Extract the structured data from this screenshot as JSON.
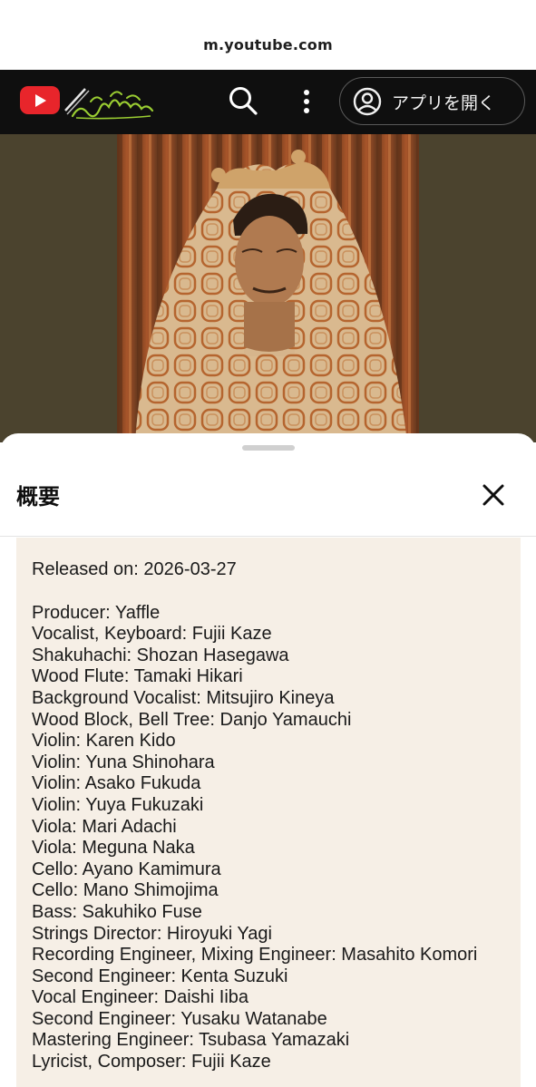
{
  "browser": {
    "url": "m.youtube.com"
  },
  "header": {
    "logo_icon": "youtube-logo-icon",
    "doodle_icon": "youtube-doodle-icon",
    "search_icon": "search-icon",
    "more_icon": "more-vert-icon",
    "open_app_label": "アプリを開く",
    "open_app_icon": "account-circle-icon"
  },
  "sheet": {
    "title": "概要",
    "close_icon": "close-icon",
    "released": "Released on: 2026-03-27",
    "credits": [
      "Producer: Yaffle",
      "Vocalist, Keyboard: Fujii Kaze",
      "Shakuhachi: Shozan Hasegawa",
      "Wood Flute: Tamaki Hikari",
      "Background Vocalist: Mitsujiro Kineya",
      "Wood Block, Bell Tree: Danjo Yamauchi",
      "Violin: Karen Kido",
      "Violin: Yuna Shinohara",
      "Violin: Asako Fukuda",
      "Violin: Yuya Fukuzaki",
      "Viola: Mari Adachi",
      "Viola: Meguna Naka",
      "Cello: Ayano Kamimura",
      "Cello: Mano Shimojima",
      "Bass: Sakuhiko Fuse",
      "Strings Director: Hiroyuki Yagi",
      "Recording Engineer, Mixing Engineer: Masahito Komori",
      "Second Engineer: Kenta Suzuki",
      "Vocal Engineer: Daishi Iiba",
      "Second Engineer: Yusaku Watanabe",
      "Mastering Engineer: Tsubasa Yamazaki",
      "Lyricist, Composer: Fujii Kaze"
    ]
  },
  "colors": {
    "header_bg": "#0f0f0f",
    "brand_red": "#e8252b",
    "doodle_green": "#9acd32",
    "thumb_bg": "#4b432e",
    "description_bg": "#f6efe6"
  }
}
